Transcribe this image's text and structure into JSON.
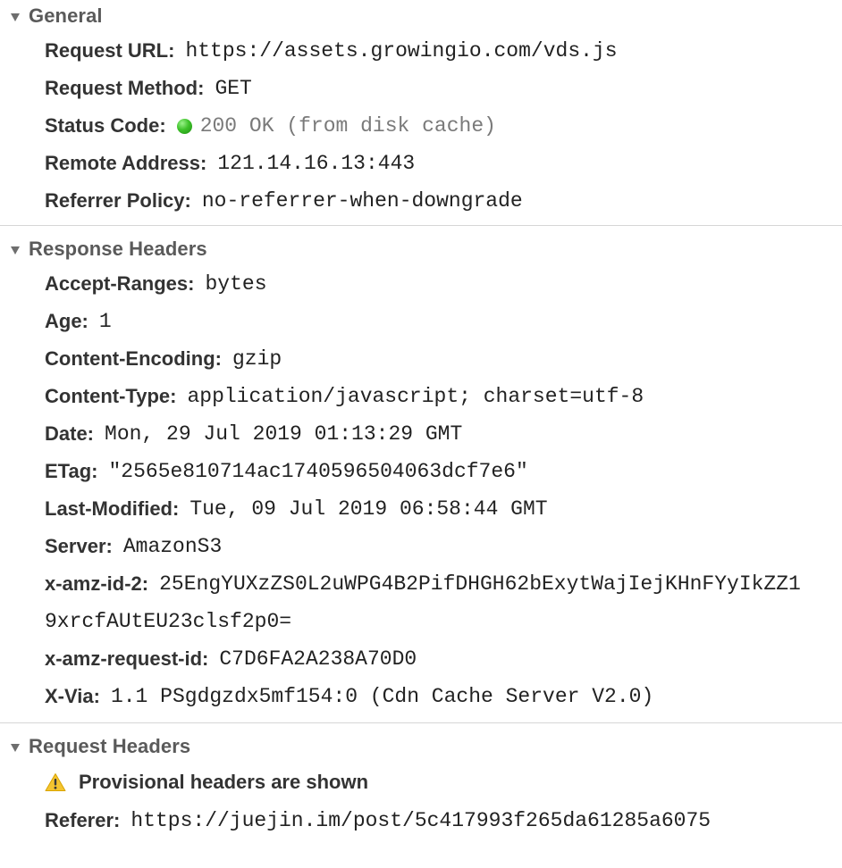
{
  "general": {
    "title": "General",
    "request_url": {
      "key": "Request URL:",
      "value": "https://assets.growingio.com/vds.js"
    },
    "request_method": {
      "key": "Request Method:",
      "value": "GET"
    },
    "status_code": {
      "key": "Status Code:",
      "value": "200 OK (from disk cache)",
      "dot_color": "#3ec22a"
    },
    "remote_address": {
      "key": "Remote Address:",
      "value": "121.14.16.13:443"
    },
    "referrer_policy": {
      "key": "Referrer Policy:",
      "value": "no-referrer-when-downgrade"
    }
  },
  "response_headers": {
    "title": "Response Headers",
    "accept_ranges": {
      "key": "Accept-Ranges:",
      "value": "bytes"
    },
    "age": {
      "key": "Age:",
      "value": "1"
    },
    "content_encoding": {
      "key": "Content-Encoding:",
      "value": "gzip"
    },
    "content_type": {
      "key": "Content-Type:",
      "value": "application/javascript; charset=utf-8"
    },
    "date": {
      "key": "Date:",
      "value": "Mon, 29 Jul 2019 01:13:29 GMT"
    },
    "etag": {
      "key": "ETag:",
      "value": "\"2565e810714ac1740596504063dcf7e6\""
    },
    "last_modified": {
      "key": "Last-Modified:",
      "value": "Tue, 09 Jul 2019 06:58:44 GMT"
    },
    "server": {
      "key": "Server:",
      "value": "AmazonS3"
    },
    "x_amz_id_2": {
      "key": "x-amz-id-2:",
      "value_line1": "25EngYUXzZS0L2uWPG4B2PifDHGH62bExytWajIejKHnFYyIkZZ1",
      "value_line2": "9xrcfAUtEU23clsf2p0="
    },
    "x_amz_request_id": {
      "key": "x-amz-request-id:",
      "value": "C7D6FA2A238A70D0"
    },
    "x_via": {
      "key": "X-Via:",
      "value": "1.1 PSgdgzdx5mf154:0 (Cdn Cache Server V2.0)"
    }
  },
  "request_headers": {
    "title": "Request Headers",
    "warning": "Provisional headers are shown",
    "warning_icon": "warning-triangle-icon",
    "referer": {
      "key": "Referer:",
      "value": "https://juejin.im/post/5c417993f265da61285a6075"
    }
  }
}
